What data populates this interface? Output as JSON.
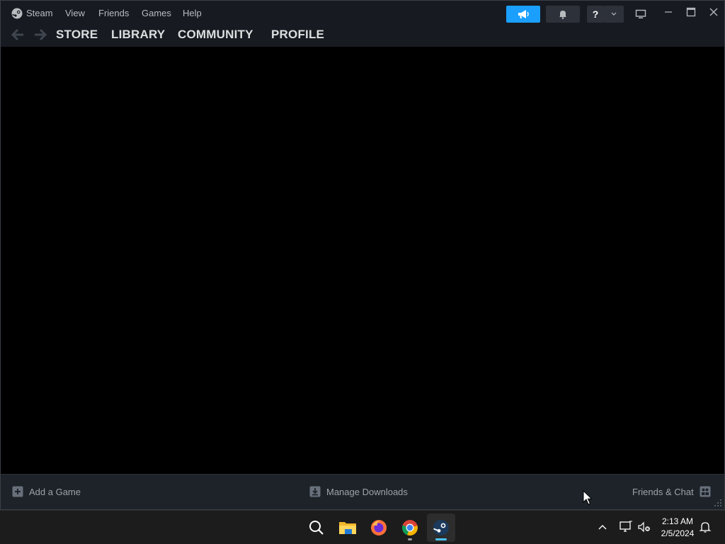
{
  "window": {
    "menu": {
      "steam": "Steam",
      "view": "View",
      "friends": "Friends",
      "games": "Games",
      "help": "Help"
    },
    "titlebar_icons": {
      "announce": "megaphone-icon",
      "notifications": "bell-icon",
      "help": "?",
      "help_dropdown": "chevron-down-icon",
      "big_picture": "monitor-icon"
    },
    "nav": {
      "tabs": [
        "STORE",
        "LIBRARY",
        "COMMUNITY",
        "PROFILE"
      ]
    },
    "bottom_bar": {
      "add_game": "Add a Game",
      "manage_downloads": "Manage Downloads",
      "friends_chat": "Friends & Chat"
    },
    "colors": {
      "accent": "#1a9fff",
      "window_bg": "#171a21",
      "content_bg": "#000000",
      "bottom_bar_bg": "#1e2329"
    }
  },
  "taskbar": {
    "apps": [
      "search-icon",
      "file-explorer-icon",
      "firefox-icon",
      "chrome-icon",
      "steam-icon"
    ],
    "clock": {
      "time": "2:13 AM",
      "date": "2/5/2024"
    }
  }
}
